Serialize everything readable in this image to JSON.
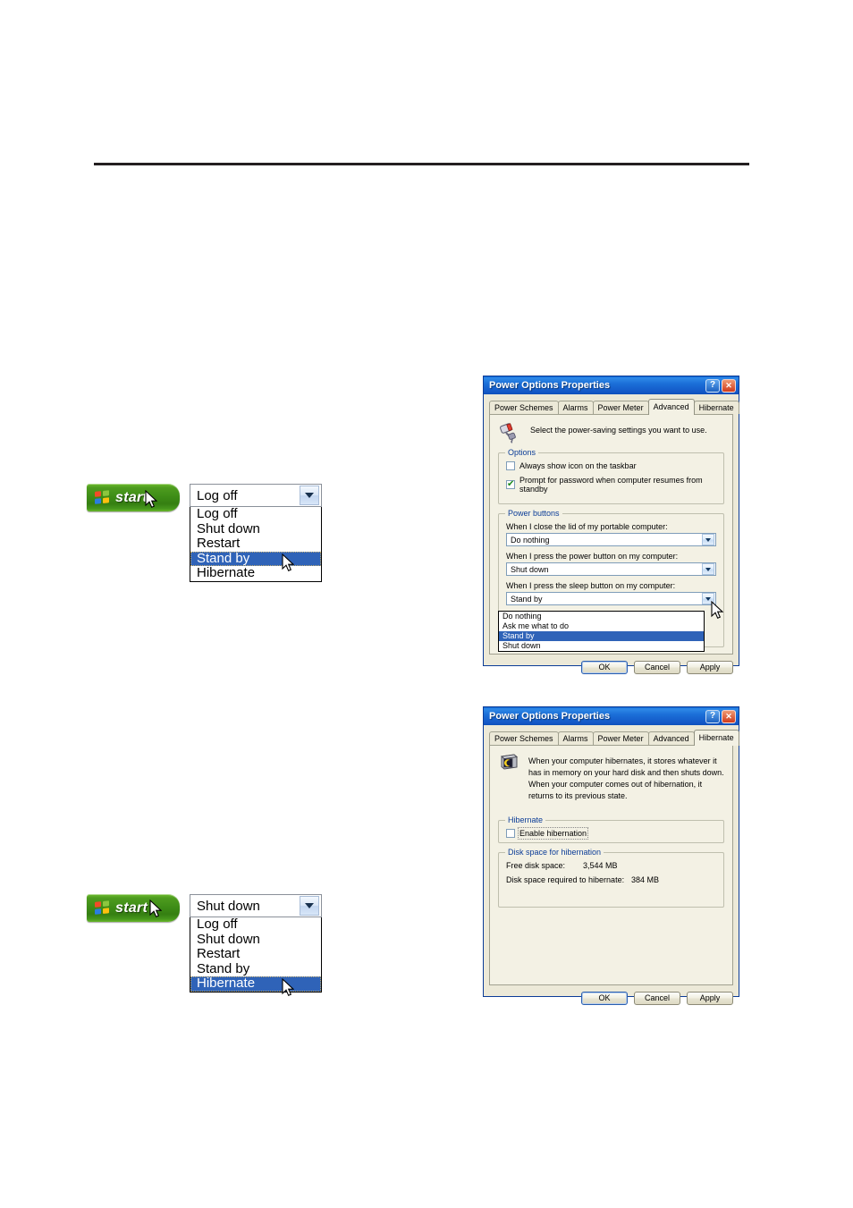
{
  "page": {
    "rule_present": true
  },
  "start_menu_1": {
    "start_label": "start",
    "combo_value": "Log off",
    "options": [
      "Log off",
      "Shut down",
      "Restart",
      "Stand by",
      "Hibernate"
    ],
    "selected": "Stand by",
    "selected_index": 3
  },
  "start_menu_2": {
    "start_label": "start",
    "combo_value": "Shut down",
    "options": [
      "Log off",
      "Shut down",
      "Restart",
      "Stand by",
      "Hibernate"
    ],
    "selected": "Hibernate",
    "selected_index": 4
  },
  "dialog_advanced": {
    "title": "Power Options Properties",
    "help_button": "?",
    "close_button": "✕",
    "tabs": [
      {
        "label": "Power Schemes",
        "active": false
      },
      {
        "label": "Alarms",
        "active": false
      },
      {
        "label": "Power Meter",
        "active": false
      },
      {
        "label": "Advanced",
        "active": true
      },
      {
        "label": "Hibernate",
        "active": false
      }
    ],
    "header_text": "Select the power-saving settings you want to use.",
    "options_group": {
      "title": "Options",
      "checkbox_taskbar": {
        "label": "Always show icon on the taskbar",
        "checked": false
      },
      "checkbox_password": {
        "label": "Prompt for password when computer resumes from standby",
        "checked": true
      }
    },
    "power_buttons_group": {
      "title": "Power buttons",
      "lid_label": "When I close the lid of my portable computer:",
      "lid_value": "Do nothing",
      "power_label": "When I press the power button on my computer:",
      "power_value": "Shut down",
      "sleep_label": "When I press the sleep button on my computer:",
      "sleep_value": "Stand by",
      "sleep_options": [
        "Do nothing",
        "Ask me what to do",
        "Stand by",
        "Shut down"
      ],
      "sleep_selected_index": 2
    },
    "buttons": {
      "ok": "OK",
      "cancel": "Cancel",
      "apply": "Apply"
    }
  },
  "dialog_hibernate": {
    "title": "Power Options Properties",
    "help_button": "?",
    "close_button": "✕",
    "tabs": [
      {
        "label": "Power Schemes",
        "active": false
      },
      {
        "label": "Alarms",
        "active": false
      },
      {
        "label": "Power Meter",
        "active": false
      },
      {
        "label": "Advanced",
        "active": false
      },
      {
        "label": "Hibernate",
        "active": true
      }
    ],
    "header_text": "When your computer hibernates, it stores whatever it has in memory on your hard disk and then shuts down. When your computer comes out of hibernation, it returns to its previous state.",
    "hibernate_group": {
      "title": "Hibernate",
      "checkbox_enable": {
        "label": "Enable hibernation",
        "checked": false
      }
    },
    "disk_group": {
      "title": "Disk space for hibernation",
      "free_label": "Free disk space:",
      "free_value": "3,544 MB",
      "required_label": "Disk space required to hibernate:",
      "required_value": "384 MB"
    },
    "buttons": {
      "ok": "OK",
      "cancel": "Cancel",
      "apply": "Apply"
    }
  },
  "colors": {
    "titlebar_blue": "#1b6fd8",
    "highlight_blue": "#2f63b8",
    "group_title_blue": "#0b3c97",
    "dialog_face": "#ece9d8",
    "tabpage_face": "#f3f1e4",
    "start_green": "#3d8c16",
    "rule_black": "#231f20"
  }
}
